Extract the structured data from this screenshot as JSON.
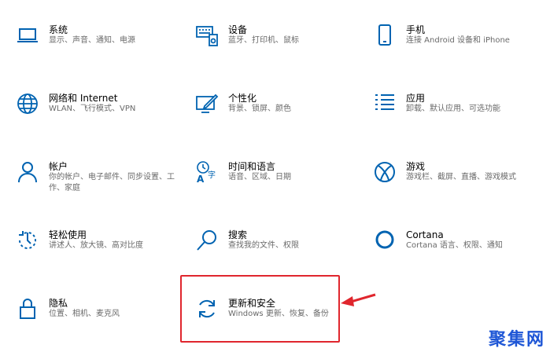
{
  "tiles": [
    {
      "id": "system",
      "title": "系统",
      "desc": "显示、声音、通知、电源",
      "icon": "laptop-icon"
    },
    {
      "id": "devices",
      "title": "设备",
      "desc": "蓝牙、打印机、鼠标",
      "icon": "keyboard-icon"
    },
    {
      "id": "phone",
      "title": "手机",
      "desc": "连接 Android 设备和 iPhone",
      "icon": "phone-icon"
    },
    {
      "id": "network",
      "title": "网络和 Internet",
      "desc": "WLAN、飞行模式、VPN",
      "icon": "globe-icon"
    },
    {
      "id": "personalization",
      "title": "个性化",
      "desc": "背景、锁屏、颜色",
      "icon": "paint-icon"
    },
    {
      "id": "apps",
      "title": "应用",
      "desc": "卸载、默认应用、可选功能",
      "icon": "apps-list-icon"
    },
    {
      "id": "accounts",
      "title": "帐户",
      "desc": "你的帐户、电子邮件、同步设置、工作、家庭",
      "icon": "person-icon"
    },
    {
      "id": "time",
      "title": "时间和语言",
      "desc": "语音、区域、日期",
      "icon": "language-icon"
    },
    {
      "id": "gaming",
      "title": "游戏",
      "desc": "游戏栏、截屏、直播、游戏模式",
      "icon": "xbox-icon"
    },
    {
      "id": "ease",
      "title": "轻松使用",
      "desc": "讲述人、放大镜、高对比度",
      "icon": "ease-of-access-icon"
    },
    {
      "id": "search",
      "title": "搜索",
      "desc": "查找我的文件、权限",
      "icon": "search-icon"
    },
    {
      "id": "cortana",
      "title": "Cortana",
      "desc": "Cortana 语言、权限、通知",
      "icon": "cortana-icon"
    },
    {
      "id": "privacy",
      "title": "隐私",
      "desc": "位置、相机、麦克风",
      "icon": "lock-icon"
    },
    {
      "id": "update",
      "title": "更新和安全",
      "desc": "Windows 更新、恢复、备份",
      "icon": "sync-icon"
    }
  ],
  "highlight": {
    "target": "update",
    "color": "#e0262d"
  },
  "accent": "#0063b1",
  "watermark": "聚集网"
}
